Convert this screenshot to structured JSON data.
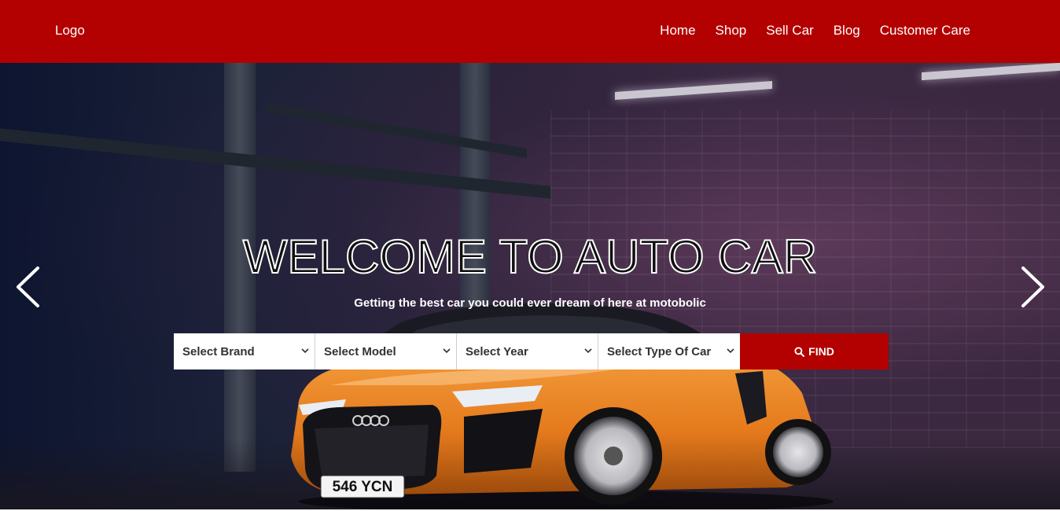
{
  "navbar": {
    "logo": "Logo",
    "links": [
      "Home",
      "Shop",
      "Sell Car",
      "Blog",
      "Customer Care"
    ],
    "background_color": "#b30000"
  },
  "hero": {
    "title": "WELCOME TO AUTO CAR",
    "subtitle": "Getting the best car you could ever dream of here at motobolic",
    "license_plate": "546 YCN",
    "prev_icon": "chevron-left-icon",
    "next_icon": "chevron-right-icon"
  },
  "search": {
    "brand_label": "Select Brand",
    "model_label": "Select Model",
    "year_label": "Select Year",
    "type_label": "Select Type Of Car",
    "find_label": "FIND",
    "find_icon": "search-icon",
    "accent_color": "#b30000"
  }
}
